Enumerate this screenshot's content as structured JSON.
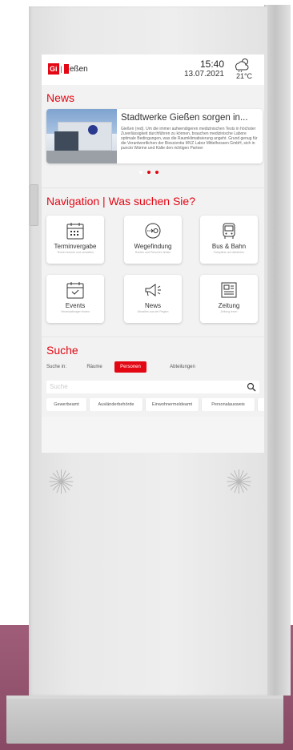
{
  "header": {
    "logo_box": "Gi",
    "logo_text": "eßen",
    "time": "15:40",
    "date": "13.07.2021",
    "temperature": "21°C",
    "weather_icon": "cloud-sun-rain-icon"
  },
  "news": {
    "title": "News",
    "headline": "Stadtwerke Gießen sorgen in...",
    "body": "Gießen (red). Um die immer aufwendigeren medizinischen Tests in höchster Zuverlässigkeit durchführen zu können, brauchen medizinische Labore optimale Bedingungen, was die Raumklimatisierung angeht. Grund genug für die Verantwortlichen der Bioscientia MVZ Labor Mittelhessen GmbH, sich in puncto Wärme und Kälte den richtigen Partner",
    "active_dot": 2
  },
  "navigation": {
    "title": "Navigation | Was suchen Sie?",
    "tiles": [
      {
        "label": "Terminvergabe",
        "sub": "Termin buchen und verwalten",
        "icon": "calendar-icon"
      },
      {
        "label": "Wegefindung",
        "sub": "Routen und Personen finden",
        "icon": "route-icon"
      },
      {
        "label": "Bus & Bahn",
        "sub": "Fahrpläne und Abfahrten",
        "icon": "bus-icon"
      },
      {
        "label": "Events",
        "sub": "Veranstaltungen finden",
        "icon": "calendar-check-icon"
      },
      {
        "label": "News",
        "sub": "Aktuelles aus der Region",
        "icon": "megaphone-icon"
      },
      {
        "label": "Zeitung",
        "sub": "Zeitung lesen",
        "icon": "newspaper-icon"
      }
    ]
  },
  "search": {
    "title": "Suche",
    "search_in": "Suche in:",
    "filters": [
      "Räume",
      "Personen",
      "Abteilungen"
    ],
    "active_filter": "Personen",
    "placeholder": "Suche",
    "chips": [
      "Gewerbeamt",
      "Ausländerbehörde",
      "Einwohnermeldeamt",
      "Personalausweis"
    ]
  },
  "colors": {
    "accent": "#e30613",
    "kiosk_body": "#e8e8e8",
    "floor": "#9a5472"
  }
}
